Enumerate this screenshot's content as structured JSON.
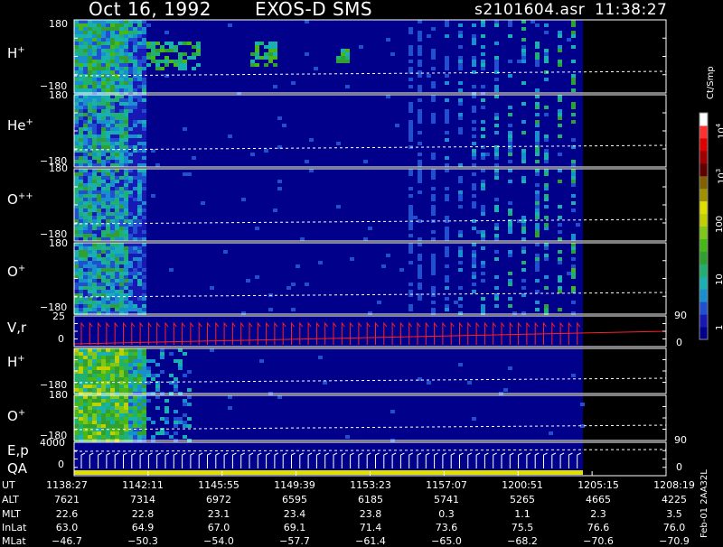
{
  "header": {
    "date": "Oct 16, 1992",
    "instrument": "EXOS-D SMS",
    "file": "s2101604.asr",
    "time": "11:38:27"
  },
  "colorbar": {
    "unit": "Ct/Smp",
    "ticks": [
      {
        "base": "10",
        "exp": "4",
        "level": 4
      },
      {
        "base": "10",
        "exp": "3",
        "level": 3
      },
      {
        "base": "100",
        "exp": "",
        "level": 2
      },
      {
        "base": "10",
        "exp": "",
        "level": 1
      },
      {
        "base": "1",
        "exp": "",
        "level": 0
      }
    ],
    "colors": [
      "#00008b",
      "#1818b4",
      "#2050d0",
      "#1890d0",
      "#18b0b0",
      "#20b070",
      "#30a030",
      "#48b818",
      "#80c818",
      "#c0d000",
      "#e0e000",
      "#a09000",
      "#806000",
      "#600000",
      "#a00000",
      "#e00000",
      "#ff3030",
      "#ffffff"
    ]
  },
  "panels": [
    {
      "id": "h-plus-1",
      "label": "H",
      "sup": "+",
      "ymax": "180",
      "ymin": "−180"
    },
    {
      "id": "he-plus",
      "label": "He",
      "sup": "+",
      "ymax": "180",
      "ymin": "−180"
    },
    {
      "id": "o-plusplus",
      "label": "O",
      "sup": "++",
      "ymax": "180",
      "ymin": "−180"
    },
    {
      "id": "o-plus-1",
      "label": "O",
      "sup": "+",
      "ymax": "180",
      "ymin": "−180"
    },
    {
      "id": "vr",
      "label": "V,r",
      "sup": "",
      "ymax": "25",
      "ymin": "0",
      "right_top": "90",
      "right_bottom": "0"
    },
    {
      "id": "h-plus-2",
      "label": "H",
      "sup": "+",
      "ymax": "180",
      "ymin": "−180"
    },
    {
      "id": "o-plus-2",
      "label": "O",
      "sup": "+",
      "ymax": "180",
      "ymin": "−180"
    },
    {
      "id": "ep-qa",
      "label": "E,p",
      "label2": "QA",
      "sup": "",
      "ymax": "4000",
      "ymin": "0",
      "right_top": "90",
      "right_bottom": "0"
    }
  ],
  "ephemeris": {
    "labels": [
      "UT",
      "ALT",
      "MLT",
      "InLat",
      "MLat"
    ],
    "columns": [
      {
        "UT": "1138:27",
        "ALT": "7621",
        "MLT": "22.6",
        "InLat": "63.0",
        "MLat": "−46.7"
      },
      {
        "UT": "1142:11",
        "ALT": "7314",
        "MLT": "22.8",
        "InLat": "64.9",
        "MLat": "−50.3"
      },
      {
        "UT": "1145:55",
        "ALT": "6972",
        "MLT": "23.1",
        "InLat": "67.0",
        "MLat": "−54.0"
      },
      {
        "UT": "1149:39",
        "ALT": "6595",
        "MLT": "23.4",
        "InLat": "69.1",
        "MLat": "−57.7"
      },
      {
        "UT": "1153:23",
        "ALT": "6185",
        "MLT": "23.8",
        "InLat": "71.4",
        "MLat": "−61.4"
      },
      {
        "UT": "1157:07",
        "ALT": "5741",
        "MLT": "0.3",
        "InLat": "73.6",
        "MLat": "−65.0"
      },
      {
        "UT": "1200:51",
        "ALT": "5265",
        "MLT": "1.1",
        "InLat": "75.5",
        "MLat": "−68.2"
      },
      {
        "UT": "1205:15",
        "ALT": "4665",
        "MLT": "2.3",
        "InLat": "76.6",
        "MLat": "−70.6"
      },
      {
        "UT": "1208:19",
        "ALT": "4225",
        "MLT": "3.5",
        "InLat": "76.0",
        "MLat": "−70.9"
      }
    ]
  },
  "side_note": "Feb-01 2AA32L",
  "chart_data": {
    "type": "heatmap",
    "title": "Oct 16, 1992   EXOS-D SMS",
    "xlabel": "UT",
    "x_ticks": [
      "1138:27",
      "1142:11",
      "1145:55",
      "1149:39",
      "1153:23",
      "1157:07",
      "1200:51",
      "1205:15",
      "1208:19"
    ],
    "color_scale": "log",
    "color_range": [
      1,
      10000
    ],
    "color_unit": "Ct/Smp",
    "series": [
      {
        "name": "H+",
        "ylim": [
          -180,
          180
        ]
      },
      {
        "name": "He+",
        "ylim": [
          -180,
          180
        ]
      },
      {
        "name": "O++",
        "ylim": [
          -180,
          180
        ]
      },
      {
        "name": "O+",
        "ylim": [
          -180,
          180
        ]
      },
      {
        "name": "V,r",
        "ylim": [
          0,
          25
        ]
      },
      {
        "name": "H+",
        "ylim": [
          -180,
          180
        ]
      },
      {
        "name": "O+",
        "ylim": [
          -180,
          180
        ]
      },
      {
        "name": "E,p",
        "ylim": [
          0,
          4000
        ]
      }
    ]
  }
}
